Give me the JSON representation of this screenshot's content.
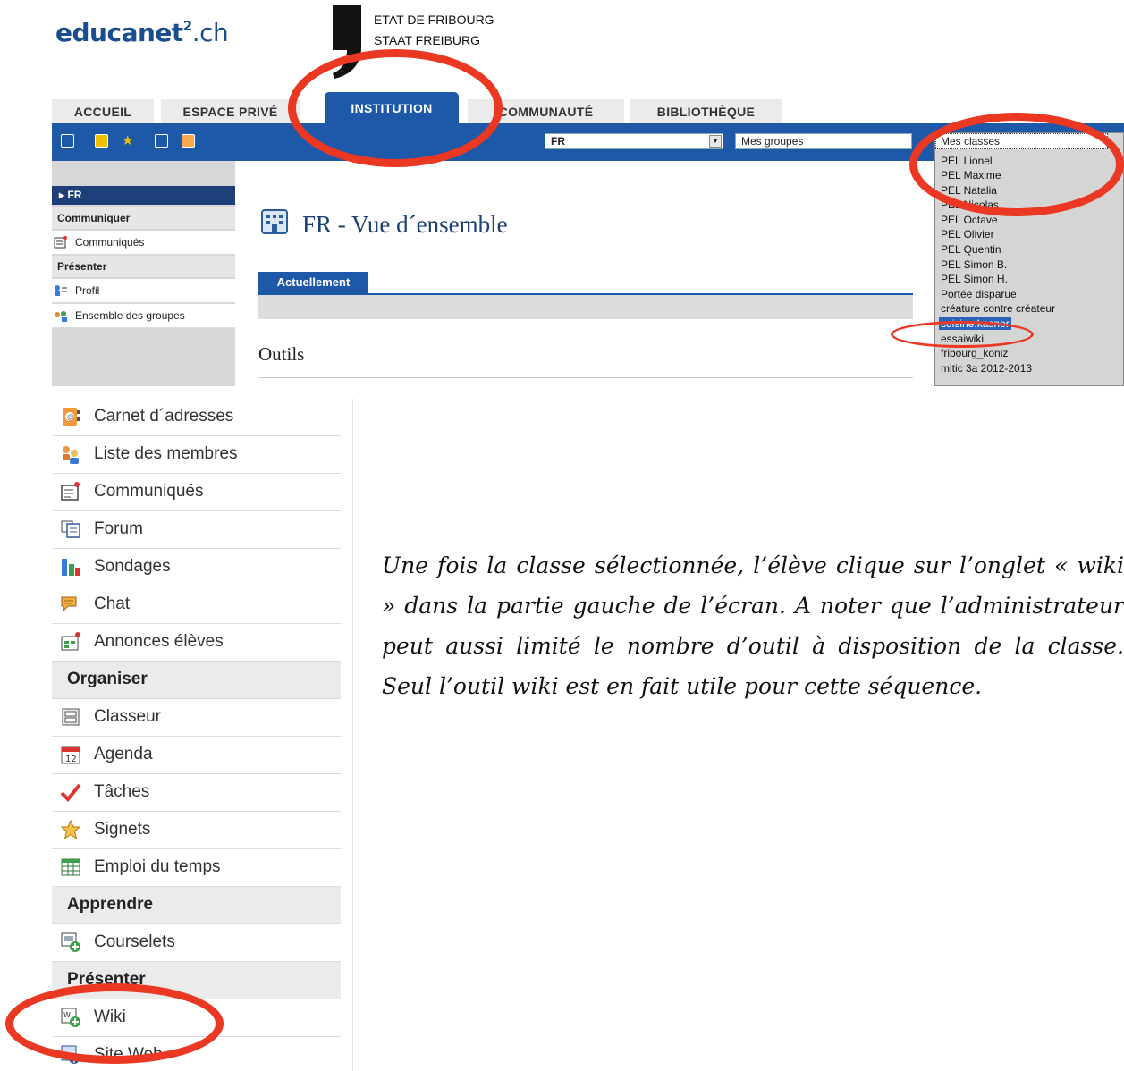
{
  "header": {
    "logo_main": "educanet",
    "logo_sup": "2",
    "logo_suffix": ".ch",
    "state_line1": "ETAT DE FRIBOURG",
    "state_line2": "STAAT FREIBURG"
  },
  "tabs": [
    {
      "label": "ACCUEIL"
    },
    {
      "label": "ESPACE PRIVÉ"
    },
    {
      "label": "INSTITUTION"
    },
    {
      "label": "COMMUNAUTÉ"
    },
    {
      "label": "BIBLIOTHÈQUE"
    }
  ],
  "toolbar": {
    "institution_select": "FR",
    "groups_select": "Mes groupes",
    "classes_select": "Mes classes"
  },
  "left_nav": {
    "current": "FR",
    "sections": [
      {
        "title": "Communiquer",
        "items": [
          "Communiqués"
        ]
      },
      {
        "title": "Présenter",
        "items": [
          "Profil",
          "Ensemble des groupes"
        ]
      }
    ]
  },
  "main": {
    "title": "FR - Vue d´ensemble",
    "subtab": "Actuellement",
    "tools_heading": "Outils"
  },
  "classes_list": [
    "PEL Lionel",
    "PEL Maxime",
    "PEL Natalia",
    "PEL Nicolas",
    "PEL Octave",
    "PEL Olivier",
    "PEL Quentin",
    "PEL Simon B.",
    "PEL Simon H.",
    "Portée disparue",
    "créature contre créateur",
    "cuisine.kasner",
    "essaiwiki",
    "fribourg_koniz",
    "mitic 3a 2012-2013"
  ],
  "tools_list": [
    {
      "label": "Carnet d´adresses",
      "type": "item",
      "icon": "address-book-icon"
    },
    {
      "label": "Liste des membres",
      "type": "item",
      "icon": "members-icon"
    },
    {
      "label": "Communiqués",
      "type": "item",
      "icon": "announcement-icon"
    },
    {
      "label": "Forum",
      "type": "item",
      "icon": "forum-icon"
    },
    {
      "label": "Sondages",
      "type": "item",
      "icon": "poll-icon"
    },
    {
      "label": "Chat",
      "type": "item",
      "icon": "chat-icon"
    },
    {
      "label": "Annonces élèves",
      "type": "item",
      "icon": "student-ads-icon"
    },
    {
      "label": "Organiser",
      "type": "section"
    },
    {
      "label": "Classeur",
      "type": "item",
      "icon": "binder-icon"
    },
    {
      "label": "Agenda",
      "type": "item",
      "icon": "calendar-icon"
    },
    {
      "label": "Tâches",
      "type": "item",
      "icon": "checkmark-icon"
    },
    {
      "label": "Signets",
      "type": "item",
      "icon": "star-icon"
    },
    {
      "label": "Emploi du temps",
      "type": "item",
      "icon": "timetable-icon"
    },
    {
      "label": "Apprendre",
      "type": "section"
    },
    {
      "label": "Courselets",
      "type": "item",
      "icon": "courselets-icon"
    },
    {
      "label": "Présenter",
      "type": "section"
    },
    {
      "label": "Wiki",
      "type": "item",
      "icon": "wiki-icon"
    },
    {
      "label": "Site Web",
      "type": "item",
      "icon": "website-icon"
    }
  ],
  "instruction_text": "Une fois la classe sélectionnée, l’élève clique sur l’onglet « wiki » dans la partie gauche de l’écran. A noter que l’administrateur peut aussi limité le nombre d’outil à disposition de la classe. Seul l’outil wiki est en fait utile pour cette séquence.",
  "colors": {
    "brand_blue": "#1e58a8",
    "nav_dark": "#1e3f7a",
    "annotation_red": "#ea3822"
  }
}
